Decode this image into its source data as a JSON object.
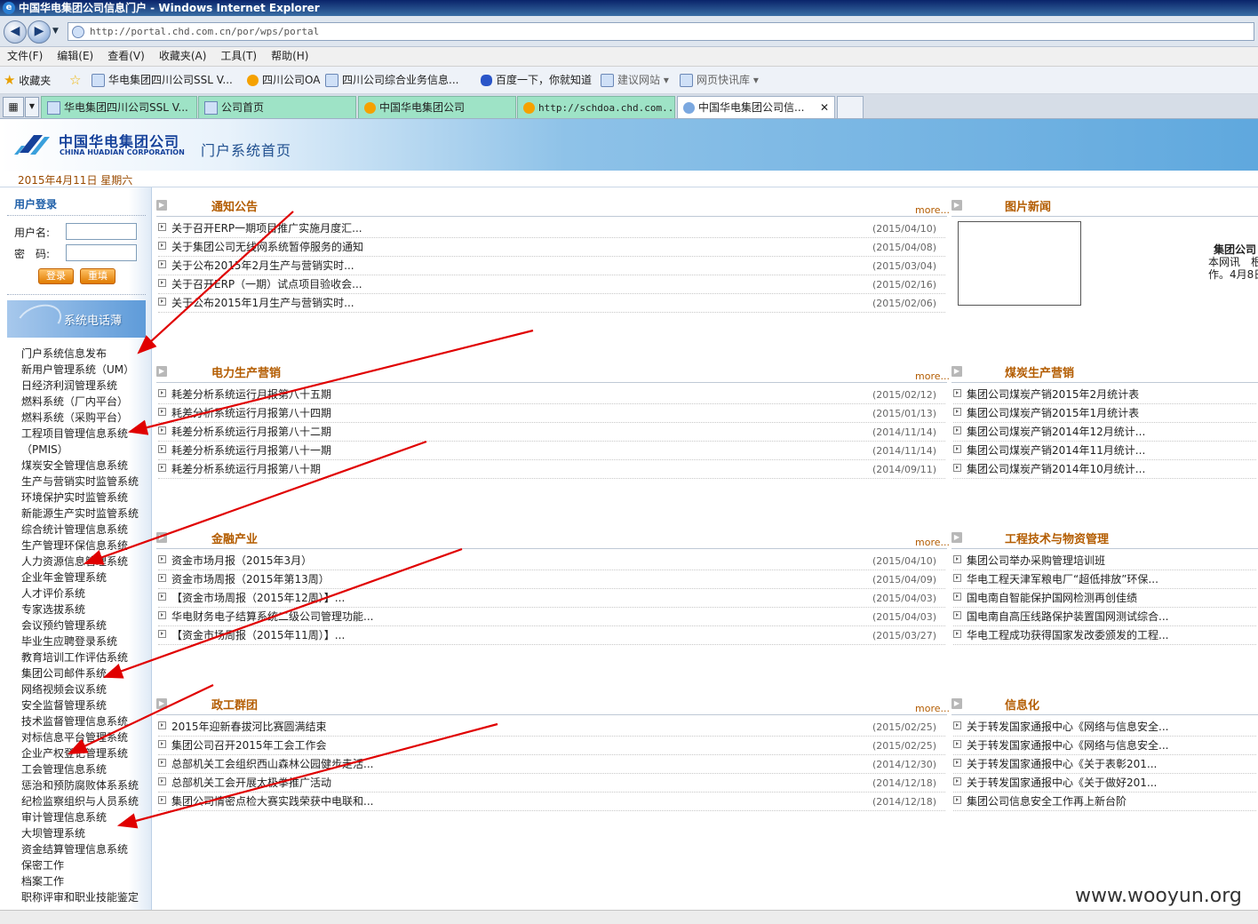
{
  "window": {
    "title": "中国华电集团公司信息门户 - Windows Internet Explorer"
  },
  "address": {
    "url": "http://portal.chd.com.cn/por/wps/portal"
  },
  "menu": [
    "文件(F)",
    "编辑(E)",
    "查看(V)",
    "收藏夹(A)",
    "工具(T)",
    "帮助(H)"
  ],
  "favorites": {
    "label": "收藏夹",
    "items": [
      "华电集团四川公司SSL V...",
      "四川公司OA",
      "四川公司综合业务信息...",
      "百度一下，你就知道",
      "建议网站 ▾",
      "网页快讯库 ▾"
    ]
  },
  "tabs": [
    "华电集团四川公司SSL V...",
    "公司首页",
    "中国华电集团公司",
    "http://schdoa.chd.com...",
    "中国华电集团公司信..."
  ],
  "header": {
    "logo_cn": "中国华电集团公司",
    "logo_en": "CHINA HUADIAN CORPORATION",
    "title": "门户系统首页",
    "date": "2015年4月11日 星期六"
  },
  "login": {
    "title": "用户登录",
    "username_label": "用户名:",
    "password_label": "密　码:",
    "login_btn": "登录",
    "reset_btn": "重填"
  },
  "phonebook": "系统电话薄",
  "systems": [
    "门户系统信息发布",
    "新用户管理系统（UM）",
    "日经济利润管理系统",
    "燃料系统（厂内平台）",
    "燃料系统（采购平台）",
    "工程项目管理信息系统",
    "（PMIS）",
    "煤炭安全管理信息系统",
    "生产与营销实时监管系统",
    "环境保护实时监管系统",
    "新能源生产实时监管系统",
    "综合统计管理信息系统",
    "生产管理环保信息系统",
    "人力资源信息管理系统",
    "企业年金管理系统",
    "人才评价系统",
    "专家选拔系统",
    "会议预约管理系统",
    "毕业生应聘登录系统",
    "教育培训工作评估系统",
    "集团公司邮件系统",
    "网络视频会议系统",
    "安全监督管理系统",
    "技术监督管理信息系统",
    "对标信息平台管理系统",
    "企业产权登记管理系统",
    "工会管理信息系统",
    "惩治和预防腐败体系系统",
    "纪检监察组织与人员系统",
    "审计管理信息系统",
    "大坝管理系统",
    "资金结算管理信息系统",
    "保密工作",
    "档案工作",
    "职称评审和职业技能鉴定"
  ],
  "more": "more...",
  "sections": {
    "notice": {
      "title": "通知公告",
      "items": [
        {
          "text": "关于召开ERP一期项目推广实施月度汇...",
          "date": "(2015/04/10)"
        },
        {
          "text": "关于集团公司无线网系统暂停服务的通知",
          "date": "(2015/04/08)"
        },
        {
          "text": "关于公布2015年2月生产与营销实时...",
          "date": "(2015/03/04)"
        },
        {
          "text": "关于召开ERP（一期）试点项目验收会...",
          "date": "(2015/02/16)"
        },
        {
          "text": "关于公布2015年1月生产与营销实时...",
          "date": "(2015/02/06)"
        }
      ]
    },
    "power": {
      "title": "电力生产营销",
      "items": [
        {
          "text": "耗差分析系统运行月报第八十五期",
          "date": "(2015/02/12)"
        },
        {
          "text": "耗差分析系统运行月报第八十四期",
          "date": "(2015/01/13)"
        },
        {
          "text": "耗差分析系统运行月报第八十二期",
          "date": "(2014/11/14)"
        },
        {
          "text": "耗差分析系统运行月报第八十一期",
          "date": "(2014/11/14)"
        },
        {
          "text": "耗差分析系统运行月报第八十期",
          "date": "(2014/09/11)"
        }
      ]
    },
    "finance": {
      "title": "金融产业",
      "items": [
        {
          "text": "资金市场月报（2015年3月）",
          "date": "(2015/04/10)"
        },
        {
          "text": "资金市场周报（2015年第13周）",
          "date": "(2015/04/09)"
        },
        {
          "text": "【资金市场周报（2015年12周）】...",
          "date": "(2015/04/03)"
        },
        {
          "text": "华电财务电子结算系统二级公司管理功能...",
          "date": "(2015/04/03)"
        },
        {
          "text": "【资金市场周报（2015年11周）】...",
          "date": "(2015/03/27)"
        }
      ]
    },
    "party": {
      "title": "政工群团",
      "items": [
        {
          "text": "2015年迎新春拔河比赛圆满结束",
          "date": "(2015/02/25)"
        },
        {
          "text": "集团公司召开2015年工会工作会",
          "date": "(2015/02/25)"
        },
        {
          "text": "总部机关工会组织西山森林公园健步走活...",
          "date": "(2014/12/30)"
        },
        {
          "text": "总部机关工会开展太极拳推广活动",
          "date": "(2014/12/18)"
        },
        {
          "text": "集团公司情密点检大赛实践荣获中电联和...",
          "date": "(2014/12/18)"
        }
      ]
    },
    "photo": {
      "title": "图片新闻",
      "caption_title": "集团公司",
      "caption_text": [
        "本网讯　根",
        "作。4月8日"
      ]
    },
    "coal": {
      "title": "煤炭生产营销",
      "items": [
        "集团公司煤炭产销2015年2月统计表",
        "集团公司煤炭产销2015年1月统计表",
        "集团公司煤炭产销2014年12月统计...",
        "集团公司煤炭产销2014年11月统计...",
        "集团公司煤炭产销2014年10月统计..."
      ]
    },
    "engineering": {
      "title": "工程技术与物资管理",
      "items": [
        "集团公司举办采购管理培训班",
        "华电工程天津军粮电厂“超低排放”环保...",
        "国电南自智能保护国网检测再创佳绩",
        "国电南自高压线路保护装置国网测试综合...",
        "华电工程成功获得国家发改委颁发的工程..."
      ]
    },
    "it": {
      "title": "信息化",
      "items": [
        "关于转发国家通报中心《网络与信息安全...",
        "关于转发国家通报中心《网络与信息安全...",
        "关于转发国家通报中心《关于表彰201...",
        "关于转发国家通报中心《关于做好201...",
        "集团公司信息安全工作再上新台阶"
      ]
    }
  },
  "watermark": "www.wooyun.org",
  "colors": {
    "accent": "#b35c00",
    "link_blue": "#1f5fa8",
    "annotation_red": "#e00000"
  }
}
